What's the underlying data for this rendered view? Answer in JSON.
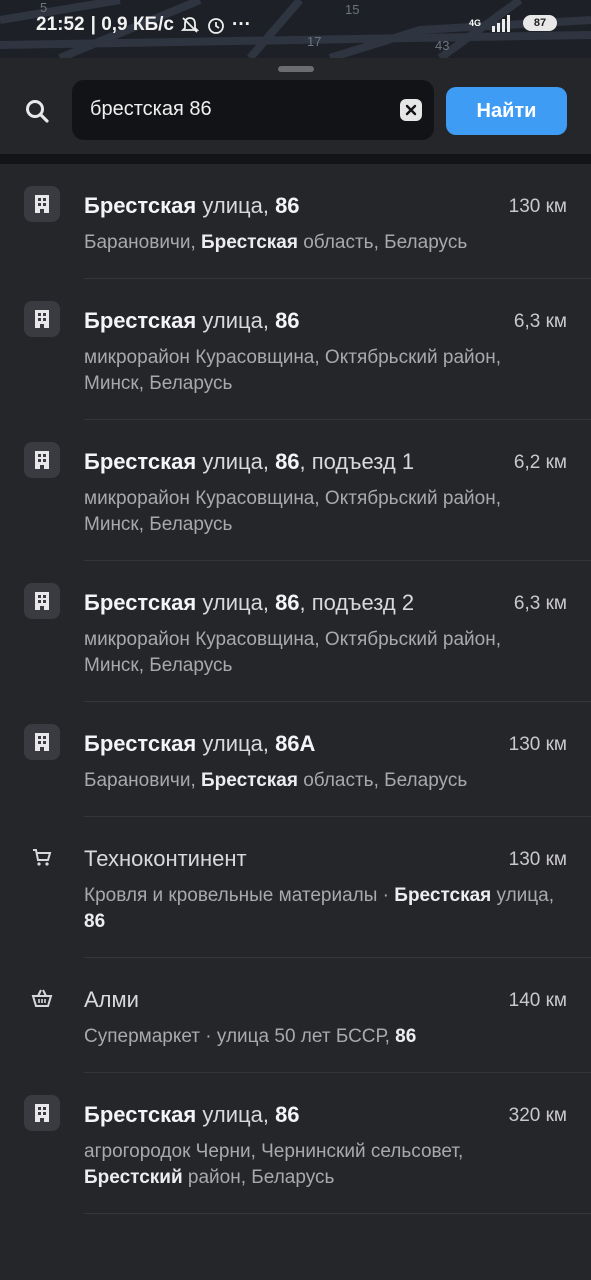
{
  "status_bar": {
    "time": "21:52",
    "speed": "| 0,9 КБ/с",
    "network": "4G",
    "battery": "87",
    "map_numbers": [
      "5",
      "15",
      "17",
      "43"
    ]
  },
  "search": {
    "query": "брестская 86",
    "find_label": "Найти"
  },
  "results": [
    {
      "title_bold": "Брестская",
      "title_rest": " улица, ",
      "title_num": "86",
      "title_suffix": "",
      "distance": "130 км",
      "sub_pre": "Барановичи, ",
      "sub_bold": "Брестская",
      "sub_post": " область, Беларусь",
      "icon": "building-icon"
    },
    {
      "title_bold": "Брестская",
      "title_rest": " улица, ",
      "title_num": "86",
      "title_suffix": "",
      "distance": "6,3 км",
      "sub_pre": "микрорайон Курасовщина, Октябрьский район, Минск, Беларусь",
      "sub_bold": "",
      "sub_post": "",
      "icon": "building-icon"
    },
    {
      "title_bold": "Брестская",
      "title_rest": " улица, ",
      "title_num": "86",
      "title_suffix": ", подъезд 1",
      "distance": "6,2 км",
      "sub_pre": "микрорайон Курасовщина, Октябрьский район, Минск, Беларусь",
      "sub_bold": "",
      "sub_post": "",
      "icon": "building-icon"
    },
    {
      "title_bold": "Брестская",
      "title_rest": " улица, ",
      "title_num": "86",
      "title_suffix": ", подъезд 2",
      "distance": "6,3 км",
      "sub_pre": "микрорайон Курасовщина, Октябрьский район, Минск, Беларусь",
      "sub_bold": "",
      "sub_post": "",
      "icon": "building-icon"
    },
    {
      "title_bold": "Брестская",
      "title_rest": " улица, ",
      "title_num": "86А",
      "title_suffix": "",
      "distance": "130 км",
      "sub_pre": "Барановичи, ",
      "sub_bold": "Брестская",
      "sub_post": " область, Беларусь",
      "icon": "building-icon"
    },
    {
      "title_bold": "",
      "title_rest": "Техноконтинент",
      "title_num": "",
      "title_suffix": "",
      "distance": "130 км",
      "sub_pre": "Кровля и кровельные материалы · ",
      "sub_bold": "Брестская",
      "sub_post": " улица, ",
      "sub_num": "86",
      "icon": "cart-icon"
    },
    {
      "title_bold": "",
      "title_rest": "Алми",
      "title_num": "",
      "title_suffix": "",
      "distance": "140 км",
      "sub_pre": "Супермаркет · улица 50 лет БССР, ",
      "sub_bold": "",
      "sub_post": "",
      "sub_num": "86",
      "icon": "basket-icon"
    },
    {
      "title_bold": "Брестская",
      "title_rest": " улица, ",
      "title_num": "86",
      "title_suffix": "",
      "distance": "320 км",
      "sub_pre": "агрогородок Черни, Чернинский сельсовет, ",
      "sub_bold": "Брестский",
      "sub_post": " район, Беларусь",
      "icon": "building-icon"
    }
  ]
}
